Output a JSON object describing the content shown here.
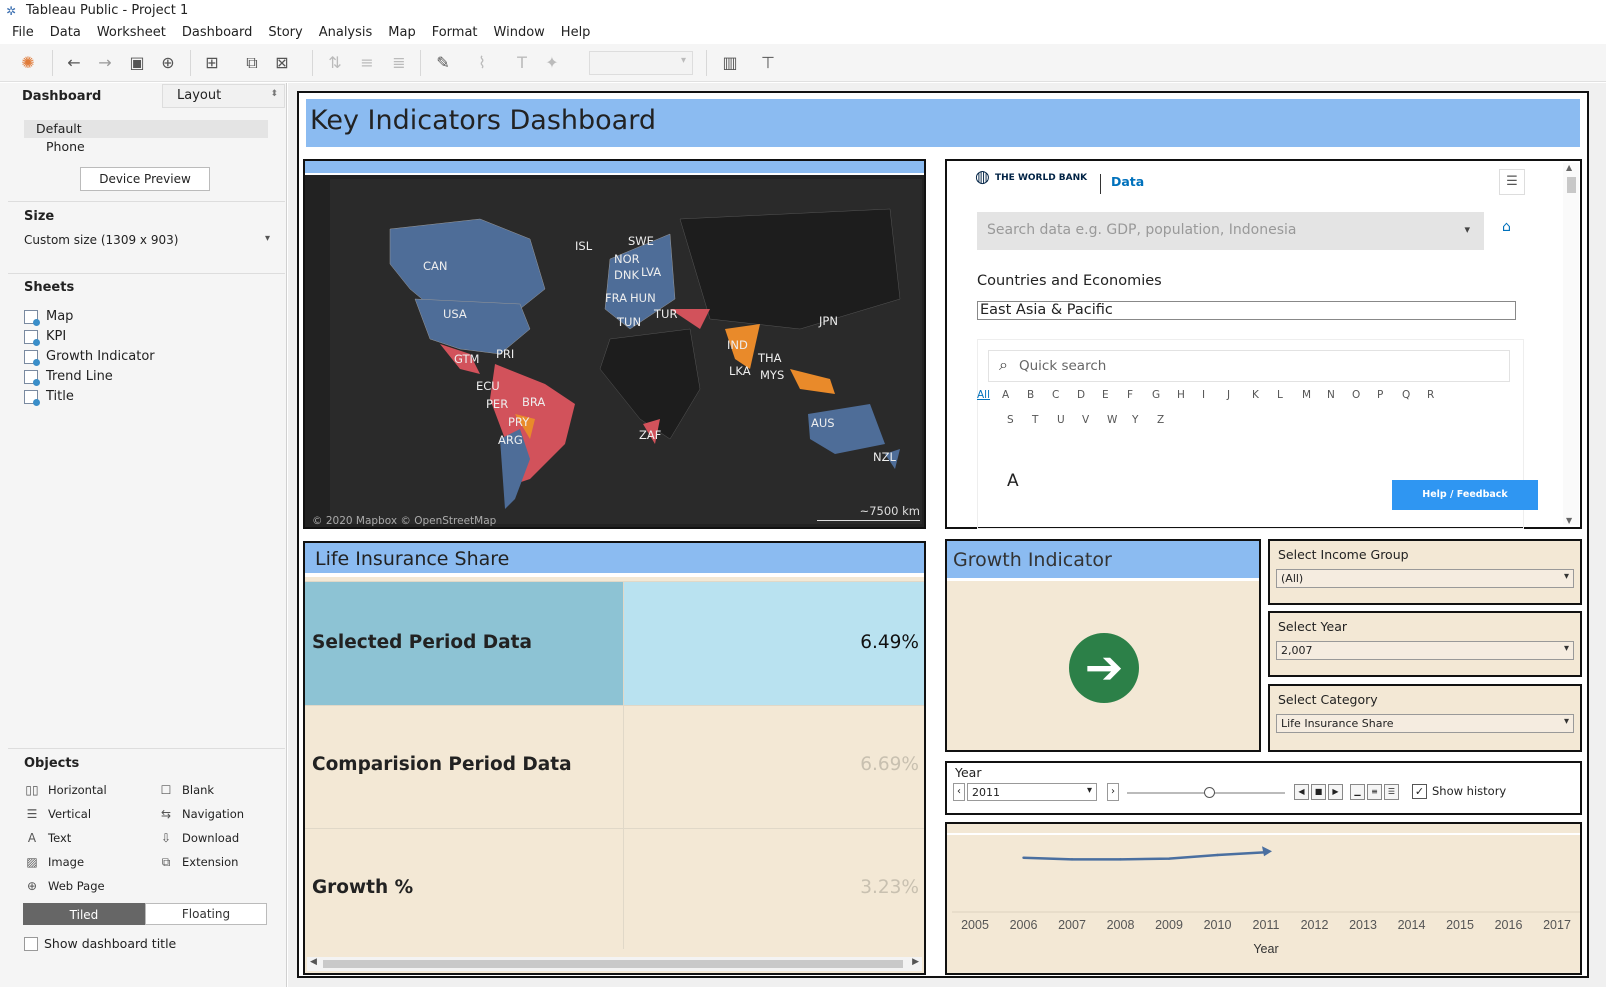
{
  "window": {
    "title": "Tableau Public - Project 1"
  },
  "menu": [
    "File",
    "Data",
    "Worksheet",
    "Dashboard",
    "Story",
    "Analysis",
    "Map",
    "Format",
    "Window",
    "Help"
  ],
  "side": {
    "tab_dashboard": "Dashboard",
    "tab_layout": "Layout",
    "devices": [
      "Default",
      "Phone"
    ],
    "device_preview": "Device Preview",
    "size_heading": "Size",
    "size_value": "Custom size (1309 x 903)",
    "sheets_heading": "Sheets",
    "sheets": [
      "Map",
      "KPI",
      "Growth Indicator",
      "Trend Line",
      "Title"
    ],
    "objects_heading": "Objects",
    "objects": [
      {
        "label": "Horizontal",
        "icon": "horizontal-icon"
      },
      {
        "label": "Blank",
        "icon": "blank-icon"
      },
      {
        "label": "Vertical",
        "icon": "vertical-icon"
      },
      {
        "label": "Navigation",
        "icon": "navigation-icon"
      },
      {
        "label": "Text",
        "icon": "text-icon"
      },
      {
        "label": "Download",
        "icon": "download-icon"
      },
      {
        "label": "Image",
        "icon": "image-icon"
      },
      {
        "label": "Extension",
        "icon": "extension-icon"
      },
      {
        "label": "Web Page",
        "icon": "web-page-icon"
      }
    ],
    "tiled": "Tiled",
    "floating": "Floating",
    "show_title": "Show dashboard title"
  },
  "dashboard": {
    "title": "Key Indicators Dashboard",
    "map": {
      "labels": [
        "CAN",
        "USA",
        "GTM",
        "PRI",
        "ECU",
        "PER",
        "BRA",
        "PRY",
        "ARG",
        "ISL",
        "SWE",
        "NOR",
        "DNK",
        "LVA",
        "FRA",
        "HUN",
        "TUN",
        "TUR",
        "IND",
        "LKA",
        "THA",
        "MYS",
        "JPN",
        "AUS",
        "NZL",
        "ZAF"
      ],
      "copyright": "© 2020 Mapbox © OpenStreetMap",
      "scale": "~7500 km"
    },
    "worldbank": {
      "logo": "THE WORLD BANK",
      "link": "Data",
      "search_placeholder": "Search data e.g. GDP, population, Indonesia",
      "heading": "Countries and Economies",
      "region": "East Asia & Pacific",
      "quick_search": "Quick search",
      "letters_row1": [
        "All",
        "A",
        "B",
        "C",
        "D",
        "E",
        "F",
        "G",
        "H",
        "I",
        "J",
        "K",
        "L",
        "M",
        "N",
        "O",
        "P",
        "Q",
        "R"
      ],
      "letters_row2": [
        "S",
        "T",
        "U",
        "V",
        "W",
        "Y",
        "Z"
      ],
      "section_letter": "A",
      "help": "Help / Feedback"
    },
    "kpi": {
      "title": "Life Insurance Share",
      "rows": [
        {
          "label": "Selected Period Data",
          "value": "6.49%"
        },
        {
          "label": "Comparision Period Data",
          "value": "6.69%"
        },
        {
          "label": "Growth %",
          "value": "3.23%"
        }
      ]
    },
    "growth": {
      "title": "Growth Indicator",
      "arrow": "➔"
    },
    "filters": [
      {
        "title": "Select Income Group",
        "value": "(All)"
      },
      {
        "title": "Select Year",
        "value": "2,007"
      },
      {
        "title": "Select Category",
        "value": "Life Insurance Share"
      }
    ],
    "year": {
      "label": "Year",
      "value": "2011",
      "show_history": "Show history",
      "checked": "✓"
    },
    "trend": {
      "colors": {
        "line": "#4a6fa0"
      }
    }
  },
  "chart_data": {
    "type": "line",
    "xlabel": "Year",
    "ylabel": "",
    "x": [
      2006,
      2007,
      2008,
      2009,
      2010,
      2011
    ],
    "y": [
      6.7,
      6.49,
      6.49,
      6.58,
      7.05,
      7.4
    ],
    "ylim": [
      0,
      10
    ],
    "ticks": [
      "2005",
      "2006",
      "2007",
      "2008",
      "2009",
      "2010",
      "2011",
      "2012",
      "2013",
      "2014",
      "2015",
      "2016",
      "2017"
    ]
  }
}
